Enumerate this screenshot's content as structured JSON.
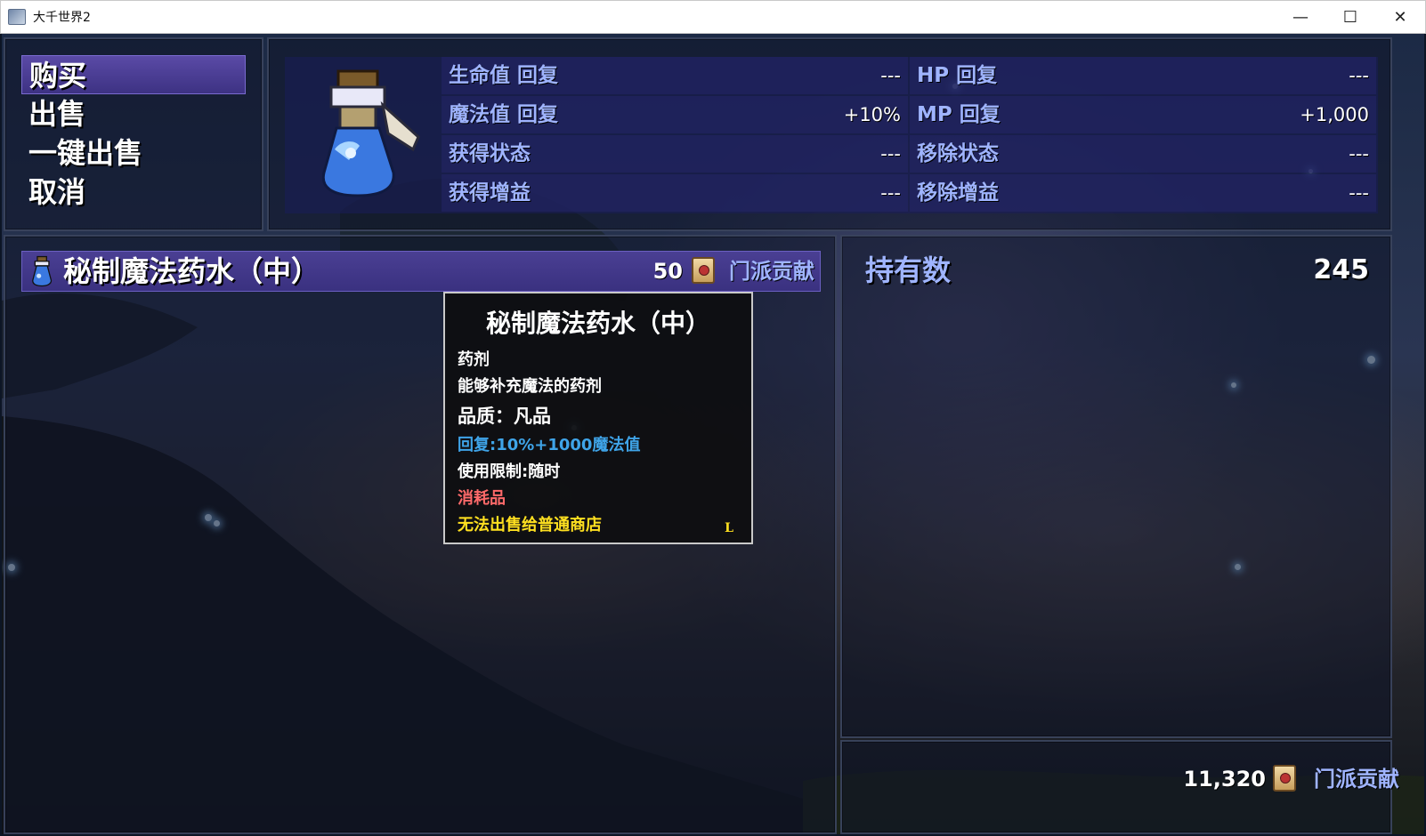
{
  "window": {
    "title": "大千世界2",
    "minimize": "—",
    "maximize": "☐",
    "close": "✕"
  },
  "commands": [
    {
      "label": "购买",
      "selected": true
    },
    {
      "label": "出售",
      "selected": false
    },
    {
      "label": "一键出售",
      "selected": false
    },
    {
      "label": "取消",
      "selected": false
    }
  ],
  "stats": {
    "left": [
      {
        "label": "生命值 回复",
        "value": "---"
      },
      {
        "label": "魔法值 回复",
        "value": "+10%"
      },
      {
        "label": "获得状态",
        "value": "---"
      },
      {
        "label": "获得增益",
        "value": "---"
      }
    ],
    "right": [
      {
        "label": "HP 回复",
        "value": "---"
      },
      {
        "label": "MP 回复",
        "value": "+1,000"
      },
      {
        "label": "移除状态",
        "value": "---"
      },
      {
        "label": "移除增益",
        "value": "---"
      }
    ]
  },
  "item": {
    "name": "秘制魔法药水（中）",
    "price": "50",
    "currency": "门派贡献"
  },
  "tooltip": {
    "title": "秘制魔法药水（中）",
    "category": "药剂",
    "description": "能够补充魔法的药剂",
    "quality": "品质：凡品",
    "effect": "回复:10%+1000魔法值",
    "usage": "使用限制:随时",
    "type": "消耗品",
    "restriction": "无法出售给普通商店",
    "corner_mark": "L",
    "colors": {
      "effect": "#3fa4e8",
      "type": "#ff6a6a",
      "restriction": "#ffe020"
    }
  },
  "possession": {
    "label": "持有数",
    "count": "245"
  },
  "gold": {
    "amount": "11,320",
    "currency": "门派贡献"
  }
}
